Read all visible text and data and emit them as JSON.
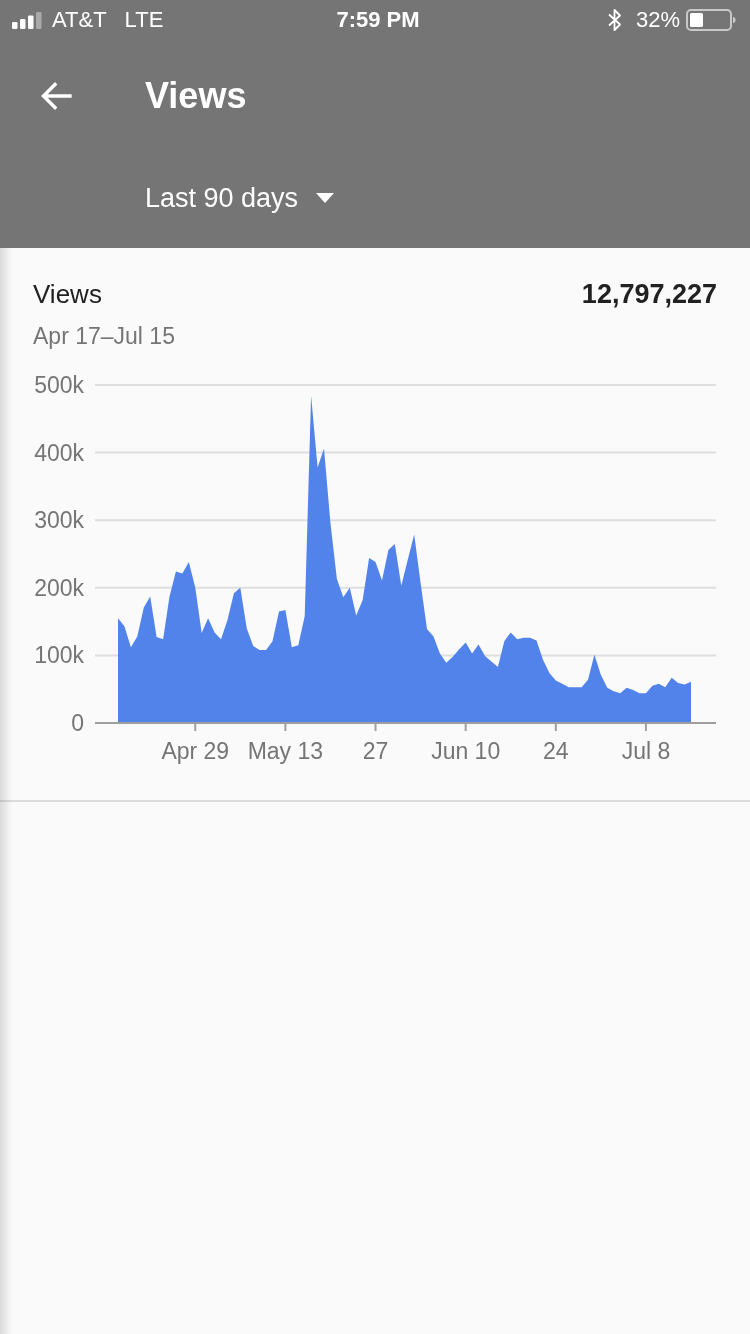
{
  "status_bar": {
    "carrier": "AT&T",
    "network": "LTE",
    "time": "7:59 PM",
    "battery": "32%"
  },
  "header": {
    "title": "Views",
    "period_dropdown": "Last 90 days"
  },
  "card": {
    "title": "Views",
    "total": "12,797,227",
    "date_range": "Apr 17–Jul 15",
    "chart_data": {
      "type": "area",
      "grid": true,
      "ylim": [
        0,
        500000
      ],
      "categories": [
        null,
        null,
        null,
        null,
        null,
        null,
        null,
        null,
        null,
        null,
        null,
        null,
        "Apr 29",
        null,
        null,
        null,
        null,
        null,
        null,
        null,
        null,
        null,
        null,
        null,
        null,
        null,
        "May 13",
        null,
        null,
        null,
        null,
        null,
        null,
        null,
        null,
        null,
        null,
        null,
        null,
        null,
        "27",
        null,
        null,
        null,
        null,
        null,
        null,
        null,
        null,
        null,
        null,
        null,
        null,
        null,
        "Jun 10",
        null,
        null,
        null,
        null,
        null,
        null,
        null,
        null,
        null,
        null,
        null,
        null,
        null,
        "24",
        null,
        null,
        null,
        null,
        null,
        null,
        null,
        null,
        null,
        null,
        null,
        null,
        null,
        "Jul 8",
        null,
        null,
        null,
        null,
        null,
        null,
        null
      ],
      "yticks": [
        {
          "value": 0,
          "label": "0"
        },
        {
          "value": 100000,
          "label": "100k"
        },
        {
          "value": 200000,
          "label": "200k"
        },
        {
          "value": 300000,
          "label": "300k"
        },
        {
          "value": 400000,
          "label": "400k"
        },
        {
          "value": 500000,
          "label": "500k"
        }
      ],
      "series": [
        {
          "color": "#5283eb",
          "values": [
            155000,
            143000,
            112000,
            128000,
            171000,
            187000,
            127000,
            124000,
            187000,
            224000,
            221000,
            238000,
            200000,
            133000,
            155000,
            134000,
            124000,
            152000,
            192000,
            200000,
            140000,
            114000,
            108000,
            108000,
            121000,
            165000,
            167000,
            112000,
            115000,
            158000,
            484000,
            378000,
            406000,
            295000,
            213000,
            186000,
            200000,
            159000,
            182000,
            244000,
            238000,
            211000,
            256000,
            265000,
            203000,
            241000,
            279000,
            207000,
            139000,
            128000,
            103000,
            89000,
            98000,
            109000,
            119000,
            103000,
            116000,
            99000,
            91000,
            83000,
            121000,
            134000,
            124000,
            126000,
            126000,
            122000,
            94000,
            74000,
            63000,
            58000,
            53000,
            53000,
            53000,
            64000,
            101000,
            71000,
            52000,
            47000,
            44000,
            52000,
            49000,
            44000,
            44000,
            55000,
            58000,
            53000,
            67000,
            59000,
            57000,
            61000
          ]
        }
      ]
    }
  }
}
